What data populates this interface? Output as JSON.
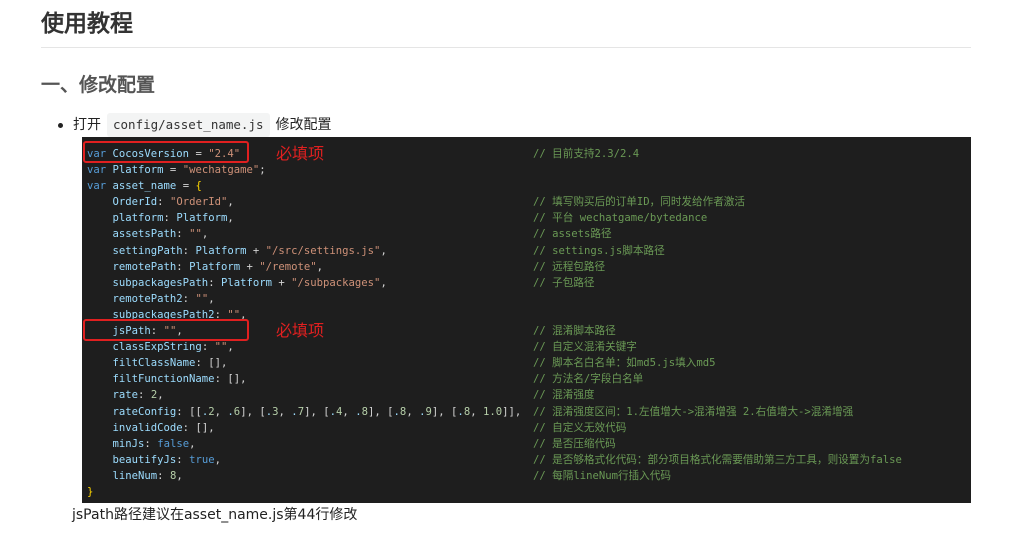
{
  "heading": "使用教程",
  "section": "一、修改配置",
  "bullet": {
    "prefix": "打开",
    "code": "config/asset_name.js",
    "suffix": "修改配置"
  },
  "annotations": {
    "required_1": "必填项",
    "required_2": "必填项"
  },
  "caption": "jsPath路径建议在asset_name.js第44行修改",
  "colors": {
    "code_bg": "#1e1e1e",
    "annotation": "#e02020",
    "comment": "#6a9955",
    "string": "#ce9178",
    "keyword": "#569cd6"
  },
  "code": {
    "lines": [
      {
        "code": "var CocosVersion = \"2.4\"",
        "comment": "// 目前支持2.3/2.4"
      },
      {
        "code": "var Platform = \"wechatgame\";",
        "comment": ""
      },
      {
        "code": "var asset_name = {",
        "comment": ""
      },
      {
        "code": "    OrderId: \"OrderId\",",
        "comment": "// 填写购买后的订单ID，同时发给作者激活"
      },
      {
        "code": "    platform: Platform,",
        "comment": "// 平台 wechatgame/bytedance"
      },
      {
        "code": "    assetsPath: \"\",",
        "comment": "// assets路径"
      },
      {
        "code": "    settingPath: Platform + \"/src/settings.js\",",
        "comment": "// settings.js脚本路径"
      },
      {
        "code": "    remotePath: Platform + \"/remote\",",
        "comment": "// 远程包路径"
      },
      {
        "code": "    subpackagesPath: Platform + \"/subpackages\",",
        "comment": "// 子包路径"
      },
      {
        "code": "    remotePath2: \"\",",
        "comment": ""
      },
      {
        "code": "    subpackagesPath2: \"\",",
        "comment": ""
      },
      {
        "code": "    jsPath: \"\",",
        "comment": "// 混淆脚本路径"
      },
      {
        "code": "    classExpString: \"\",",
        "comment": "// 自定义混淆关键字"
      },
      {
        "code": "    filtClassName: [],",
        "comment": "// 脚本名白名单：如md5.js填入md5"
      },
      {
        "code": "    filtFunctionName: [],",
        "comment": "// 方法名/字段白名单"
      },
      {
        "code": "    rate: 2,",
        "comment": "// 混淆强度"
      },
      {
        "code": "    rateConfig: [[.2, .6], [.3, .7], [.4, .8], [.8, .9], [.8, 1.0]],",
        "comment": "// 混淆强度区间：1.左值增大->混淆增强 2.右值增大->混淆增强"
      },
      {
        "code": "    invalidCode: [],",
        "comment": "// 自定义无效代码"
      },
      {
        "code": "    minJs: false,",
        "comment": "// 是否压缩代码"
      },
      {
        "code": "    beautifyJs: true,",
        "comment": "// 是否够格式化代码：部分项目格式化需要借助第三方工具，则设置为false"
      },
      {
        "code": "    lineNum: 8,",
        "comment": "// 每隔lineNum行插入代码"
      },
      {
        "code": "}",
        "comment": ""
      }
    ]
  }
}
